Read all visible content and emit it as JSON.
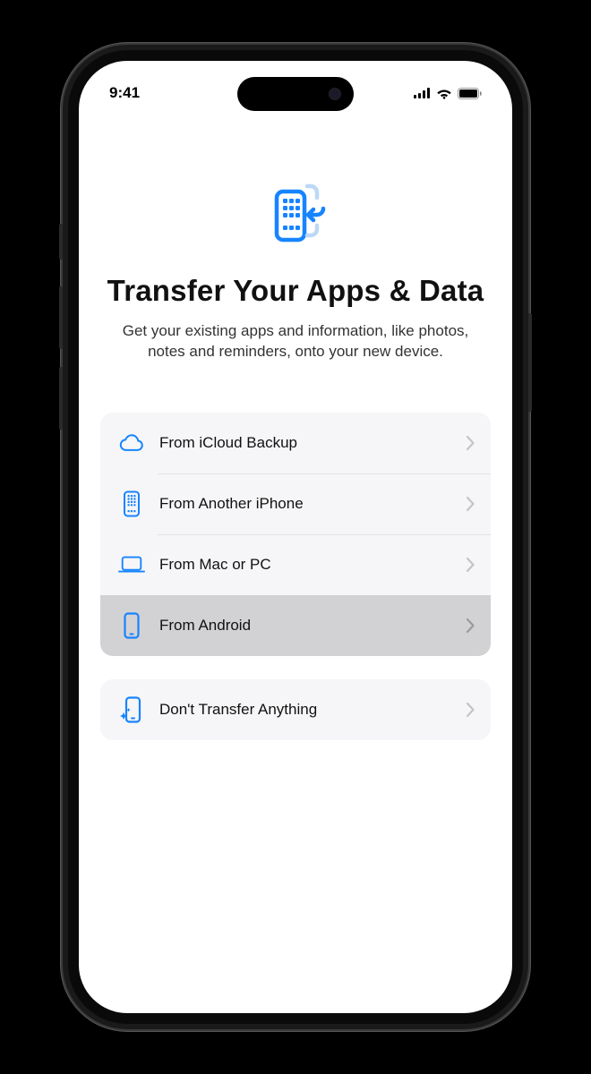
{
  "status": {
    "time": "9:41"
  },
  "header": {
    "title": "Transfer Your Apps & Data",
    "subtitle": "Get your existing apps and information, like photos, notes and reminders, onto your new device."
  },
  "options": {
    "group1": [
      {
        "icon": "cloud-icon",
        "label": "From iCloud Backup",
        "selected": false
      },
      {
        "icon": "iphone-icon",
        "label": "From Another iPhone",
        "selected": false
      },
      {
        "icon": "laptop-icon",
        "label": "From Mac or PC",
        "selected": false
      },
      {
        "icon": "phone-icon",
        "label": "From Android",
        "selected": true
      }
    ],
    "group2": [
      {
        "icon": "sparkle-phone-icon",
        "label": "Don't Transfer Anything",
        "selected": false
      }
    ]
  },
  "colors": {
    "accent": "#1784ff",
    "accent_light": "#bcd8f6"
  }
}
